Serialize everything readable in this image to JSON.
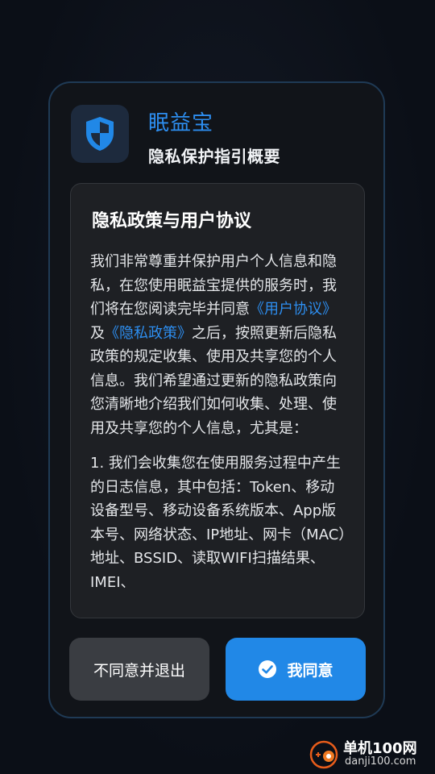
{
  "dialog": {
    "app_name": "眠益宝",
    "subtitle": "隐私保护指引概要",
    "app_icon": "shield-icon",
    "accent_color": "#2d8ef0"
  },
  "content": {
    "title": "隐私政策与用户协议",
    "para1_part1": "我们非常尊重并保护用户个人信息和隐私，在您使用眠益宝提供的服务时，我们将在您阅读完毕并同意",
    "user_agreement_link": "《用户协议》",
    "and_text": "及",
    "privacy_policy_link": "《隐私政策》",
    "para1_part2": "之后，按照更新后隐私政策的规定收集、使用及共享您的个人信息。我们希望通过更新的隐私政策向您清晰地介绍我们如何收集、处理、使用及共享您的个人信息，尤其是：",
    "para2": "1. 我们会收集您在使用服务过程中产生的日志信息，其中包括：Token、移动设备型号、移动设备系统版本、App版本号、网络状态、IP地址、网卡（MAC）地址、BSSID、读取WIFI扫描结果、IMEI、"
  },
  "buttons": {
    "decline_label": "不同意并退出",
    "agree_label": "我同意",
    "agree_icon": "check-circle-icon",
    "agree_color": "#2188e7"
  },
  "watermark": {
    "title": "单机100网",
    "url": "danji100.com"
  }
}
